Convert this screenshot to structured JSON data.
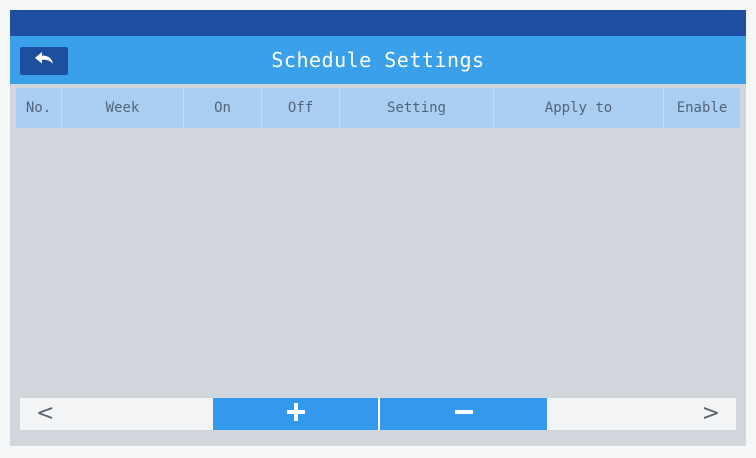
{
  "header": {
    "title": "Schedule Settings",
    "back_icon": "back-arrow-icon"
  },
  "table": {
    "columns": [
      "No.",
      "Week",
      "On",
      "Off",
      "Setting",
      "Apply to",
      "Enable"
    ],
    "rows": []
  },
  "footer": {
    "prev_label": "<",
    "next_label": ">",
    "add_icon": "plus-icon",
    "remove_icon": "minus-icon"
  },
  "colors": {
    "top_strip": "#1f4fa3",
    "title_bar": "#3aa0ea",
    "header_row": "#aacdf2",
    "body": "#d0d6db",
    "action_button": "#3399ee"
  }
}
